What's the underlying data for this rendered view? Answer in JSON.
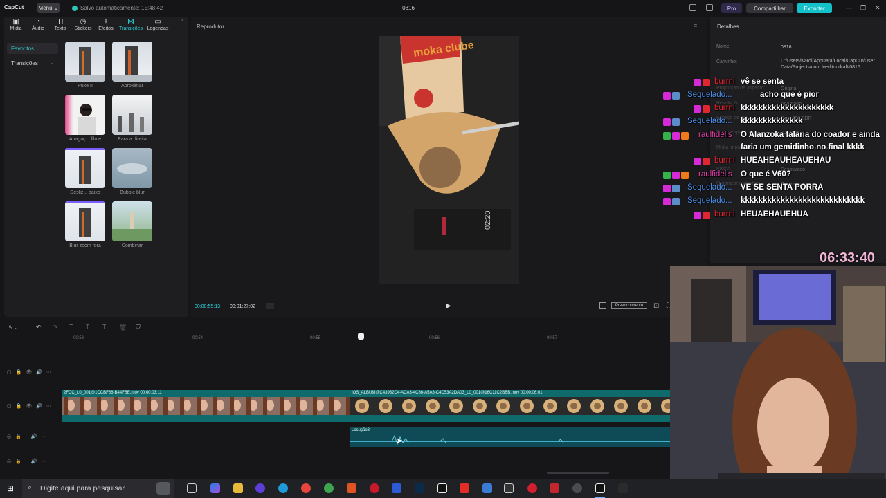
{
  "topbar": {
    "brand": "CapCut",
    "menu_label": "Menu ⌄",
    "autosave": "Salvo automaticamente: 15:48:42",
    "project_title": "0816",
    "pro_label": "Pro",
    "share_label": "Compartilhar",
    "export_label": "Exportar",
    "window_min": "—",
    "window_max": "❐",
    "window_close": "✕"
  },
  "left_panel": {
    "tabs": [
      {
        "label": "Mídia",
        "icon": "media-icon"
      },
      {
        "label": "Áudio",
        "icon": "audio-icon"
      },
      {
        "label": "Texto",
        "icon": "text-icon"
      },
      {
        "label": "Stickers",
        "icon": "sticker-icon"
      },
      {
        "label": "Efeitos",
        "icon": "effects-icon"
      },
      {
        "label": "Transições",
        "icon": "transitions-icon"
      },
      {
        "label": "Legendas",
        "icon": "captions-icon"
      }
    ],
    "sidebar": {
      "favorites": "Favoritos",
      "transitions": "Transições"
    },
    "transitions": [
      {
        "label": "Puxe II"
      },
      {
        "label": "Aproximar"
      },
      {
        "label": "Apagaç... filme"
      },
      {
        "label": "Para a direita"
      },
      {
        "label": "Desliz... baixo"
      },
      {
        "label": "Bubble blur"
      },
      {
        "label": "Blur zoom fora"
      },
      {
        "label": "Combinar"
      }
    ]
  },
  "player": {
    "title": "Reprodutor",
    "current_time": "00:00:55:13",
    "total_time": "00:01:27:02",
    "fill_label": "Preenchimento",
    "package_text": "moka clube",
    "scale_reading": "02:20"
  },
  "details": {
    "title": "Detalhes",
    "name_key": "Nome:",
    "name_value": "0816",
    "path_key": "Caminho:",
    "path_value": "C:/Users/Karol/AppData/Local/CapCut/User Data/Projects/com.lveditor.draft/0816",
    "aspect_key": "Proporção de aspecto:",
    "aspect_value": "Original",
    "res_key": "Resolução:",
    "res_value": "Adaptado",
    "color_key": "Espaço de cor:",
    "color_value": "Rec. 709 SDR",
    "fps_key": "Taxa de quadros:",
    "fps_value": "30.00fps",
    "media_key": "Mídia importada:",
    "media_value": "Manter no local original",
    "proxy_key": "Proxy:",
    "proxy_value": "Desativado",
    "layer_key": "Organizar camadas:",
    "layer_value": "Desativado"
  },
  "chat": [
    {
      "user": "burrni",
      "color": "#e0262f",
      "text": "vê se senta",
      "badges": [
        "#d62ad8",
        "#e0262f"
      ]
    },
    {
      "user": "Sequelado...",
      "color": "#4a8fe8",
      "text": "acho que é pior",
      "badges": [
        "#d62ad8",
        "#5b8ec8"
      ]
    },
    {
      "user": "burrni",
      "color": "#e0262f",
      "text": "kkkkkkkkkkkkkkkkkkkkk",
      "badges": [
        "#d62ad8",
        "#e0262f"
      ]
    },
    {
      "user": "Sequelado...",
      "color": "#4a8fe8",
      "text": "kkkkkkkkkkkkkk",
      "badges": [
        "#d62ad8",
        "#5b8ec8"
      ]
    },
    {
      "user": "raulfidelis",
      "color": "#e040a8",
      "text": "O Alanzoka falaria do coador e ainda",
      "text2": "faria um gemidinho no final kkkk",
      "badges": [
        "#34b34a",
        "#d62ad8",
        "#f07a1a"
      ]
    },
    {
      "user": "burrni",
      "color": "#e0262f",
      "text": "HUEAHEAUHEAUEHAU",
      "badges": [
        "#d62ad8",
        "#e0262f"
      ]
    },
    {
      "user": "raulfidelis",
      "color": "#e040a8",
      "text": "O que é V60?",
      "badges": [
        "#34b34a",
        "#d62ad8",
        "#f07a1a"
      ]
    },
    {
      "user": "Sequelado...",
      "color": "#4a8fe8",
      "text": "VE SE SENTA PORRA",
      "badges": [
        "#d62ad8",
        "#5b8ec8"
      ]
    },
    {
      "user": "Sequelado...",
      "color": "#4a8fe8",
      "text": "kkkkkkkkkkkkkkkkkkkkkkkkkkkk",
      "badges": [
        "#d62ad8",
        "#5b8ec8"
      ]
    },
    {
      "user": "burrni",
      "color": "#e0262f",
      "text": "HEUAEHAUEHUA",
      "badges": [
        "#d62ad8",
        "#e0262f"
      ]
    }
  ],
  "stream_clock": "06:33:40",
  "timeline": {
    "ruler": [
      "00:53",
      "00:54",
      "00:55",
      "00:56",
      "00:57"
    ],
    "clip1_label": "2FCC_L0_001@1CCBF66-B44FBE.mov  00:00:03:11",
    "clip2_label": "IOS_ALBUM@C43932C4-ACA3-4C86-A5A8-C4C53A2DA03_L0_001@16C11C2BBB.mov  00:00:06:01",
    "audio_label": "Locução3"
  },
  "taskbar": {
    "search_placeholder": "Digite aqui para pesquisar"
  }
}
